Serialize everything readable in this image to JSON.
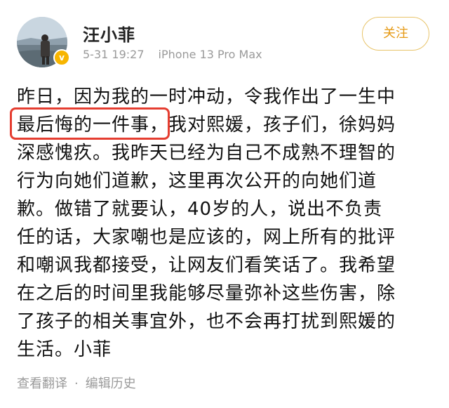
{
  "post": {
    "username": "汪小菲",
    "date": "5-31 19:27",
    "device": "iPhone 13 Pro Max",
    "follow_label": "关注",
    "verified_badge": "v",
    "text_lines": [
      "昨日，因为我的一时冲动，令我作出了一生中",
      "最后悔的一件事，我对熙媛，孩子们，徐妈妈",
      "深感愧疚。我昨天已经为自己不成熟不理智的",
      "行为向她们道歉，这里再次公开的向她们道",
      "歉。做错了就要认，40岁的人，说出不负责",
      "任的话，大家嘲也是应该的，网上所有的批评",
      "和嘲讽我都接受，让网友们看笑话了。我希望",
      "在之后的时间里我能够尽量弥补这些伤害，除",
      "了孩子的相关事宜外，也不会再打扰到熙媛的",
      "生活。小菲"
    ],
    "highlighted_phrase": "最后悔的一件事，",
    "translate_label": "查看翻译",
    "separator": "·",
    "edit_history_label": "编辑历史"
  },
  "colors": {
    "accent": "#e69a16",
    "highlight": "#e53d30",
    "verified": "#f7b500",
    "meta": "#9a9a9a"
  },
  "icons": {
    "verified": "verified-badge-icon",
    "avatar": "avatar-photo"
  }
}
